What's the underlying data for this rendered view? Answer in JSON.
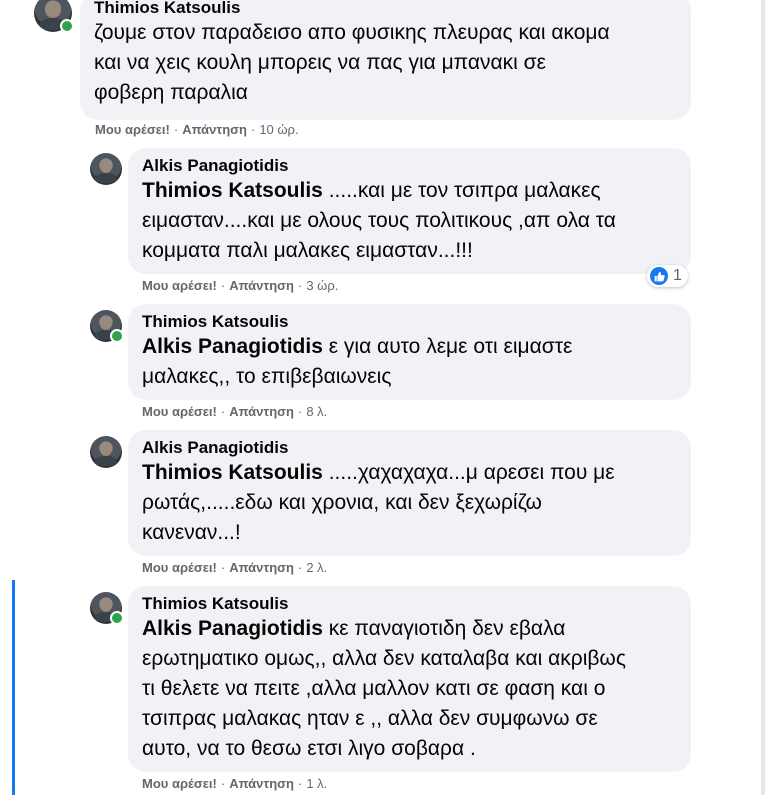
{
  "actions": {
    "like": "Μου αρέσει!",
    "reply": "Απάντηση",
    "separator": "·"
  },
  "comments": [
    {
      "author": "Thimios Katsoulis",
      "text": "ζουμε στον παραδεισο απο φυσικης πλευρας και ακομα\nκαι να χεις κουλη μπορεις να πας για μπανακι σε\nφοβερη παραλια",
      "time": "10 ώρ."
    },
    {
      "author": "Alkis Panagiotidis",
      "mention": "Thimios Katsoulis",
      "text": " .....και με τον τσιπρα μαλακες\nειμασταν....και με ολους τους πολιτικους ,απ ολα τα\nκομματα παλι μαλακες ειμασταν...!!!",
      "time": "3 ώρ.",
      "reaction": {
        "icon": "like-icon",
        "count": "1",
        "color": "#1877f2"
      }
    },
    {
      "author": "Thimios Katsoulis",
      "mention": "Alkis Panagiotidis",
      "text": " ε για αυτο λεμε οτι ειμαστε\nμαλακες,, το επιβεβαιωνεις",
      "time": "8 λ."
    },
    {
      "author": "Alkis Panagiotidis",
      "mention": "Thimios Katsoulis",
      "text": " .....χαχαχαχα...μ αρεσει που με\nρωτάς,.....εδω και χρονια, και δεν ξεχωρίζω\nκανεναν...!",
      "time": "2 λ."
    },
    {
      "author": "Thimios Katsoulis",
      "mention": "Alkis Panagiotidis",
      "text": " κε παναγιοτιδη δεν εβαλα\nερωτηματικο ομως,, αλλα δεν καταλαβα και ακριβως\nτι θελετε να πειτε ,αλλα μαλλον κατι σε φαση και ο\nτσιπρας μαλακας ηταν ε ,, αλλα δεν συμφωνω σε\nαυτο, να το θεσω ετσι λιγο σοβαρα .",
      "time": "1 λ."
    }
  ],
  "colors": {
    "bubble": "#f0f2f5",
    "meta": "#65676b",
    "online": "#31a24c",
    "thread": "#1877f2"
  }
}
